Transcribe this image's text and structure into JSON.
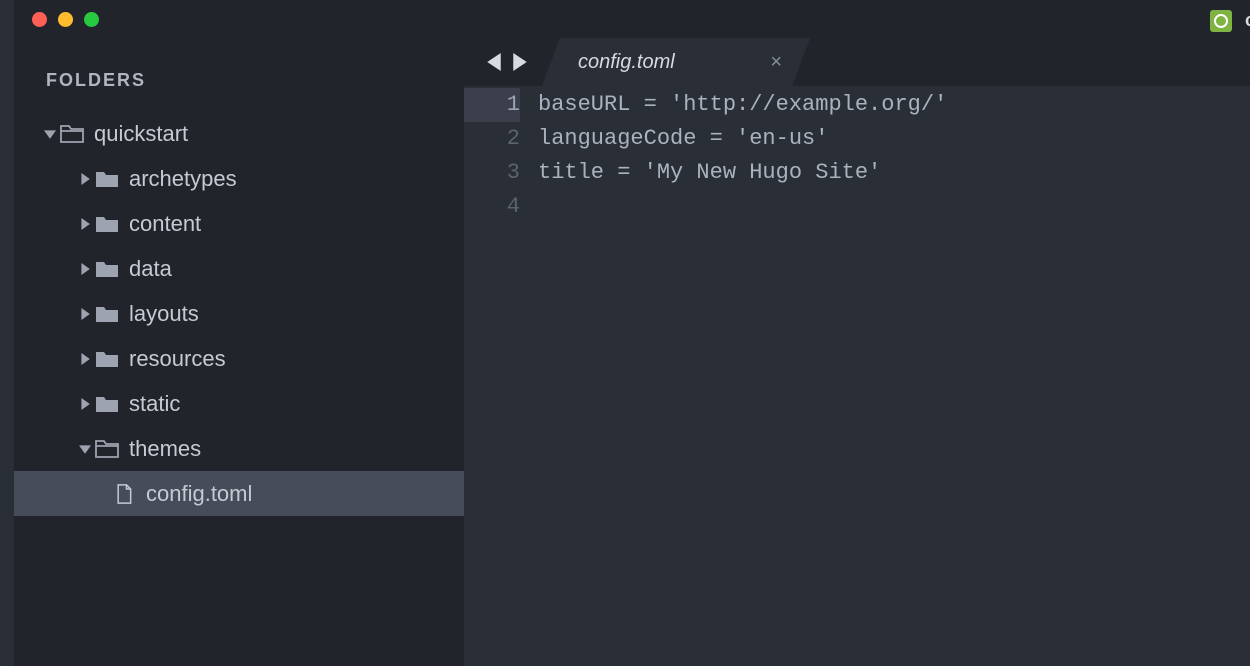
{
  "sidebar": {
    "header": "FOLDERS",
    "root": {
      "name": "quickstart",
      "type": "folder-open",
      "expanded": true,
      "children": [
        {
          "name": "archetypes",
          "type": "folder",
          "expanded": false
        },
        {
          "name": "content",
          "type": "folder",
          "expanded": false
        },
        {
          "name": "data",
          "type": "folder",
          "expanded": false
        },
        {
          "name": "layouts",
          "type": "folder",
          "expanded": false
        },
        {
          "name": "resources",
          "type": "folder",
          "expanded": false
        },
        {
          "name": "static",
          "type": "folder",
          "expanded": false
        },
        {
          "name": "themes",
          "type": "folder-open",
          "expanded": true
        },
        {
          "name": "config.toml",
          "type": "file",
          "selected": true
        }
      ]
    }
  },
  "tabs": {
    "active": {
      "label": "config.toml"
    }
  },
  "editor": {
    "active_line": 1,
    "lines": [
      "baseURL = 'http://example.org/'",
      "languageCode = 'en-us'",
      "title = 'My New Hugo Site'",
      ""
    ]
  }
}
